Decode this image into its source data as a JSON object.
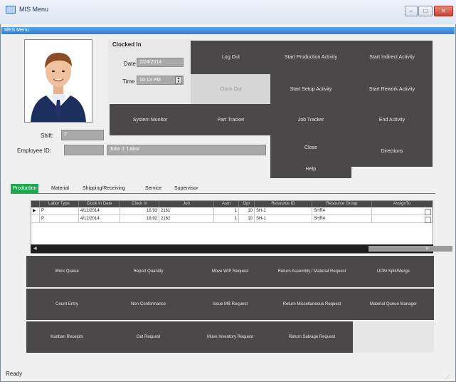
{
  "window": {
    "title": "MIS Menu",
    "menu": "MES Menu",
    "status": "Ready"
  },
  "clock": {
    "heading": "Clocked In",
    "date_label": "Date",
    "date_value": "2/24/2014",
    "time_label": "Time",
    "time_value": "10:13 PM"
  },
  "employee": {
    "shift_label": "Shift:",
    "shift_value": "2",
    "id_label": "Employee ID:",
    "id_value": "",
    "name_value": "John J. Labor"
  },
  "actions": {
    "log_out": "Log Out",
    "clock_out": "Clock Out",
    "start_production": "Start Production Activity",
    "start_indirect": "Start Indirect Activity",
    "start_setup": "Start Setup Activity",
    "start_rework": "Start Rework Activity",
    "system_monitor": "System Monitor",
    "part_tracker": "Part Tracker",
    "job_tracker": "Job Tracker",
    "end_activity": "End Activity",
    "close": "Close",
    "directions": "Directions",
    "help": "Help"
  },
  "tabs": [
    "Production",
    "Material",
    "Shipping/Receiving",
    "Service",
    "Supervisor"
  ],
  "table": {
    "headers": [
      "Labor Type",
      "Clock In Date",
      "Clock In",
      "Job",
      "Asm",
      "Opr",
      "Resource ID",
      "Resource Group",
      "AssignTo"
    ],
    "rows": [
      [
        "P",
        "4/12/2014",
        "16.93",
        "2161",
        "1",
        "10",
        "SH-1",
        "SHR4"
      ],
      [
        "P",
        "4/12/2014",
        "16.92",
        "2162",
        "1",
        "10",
        "SH-1",
        "SHR4"
      ]
    ]
  },
  "lower_buttons": [
    [
      "Work Queue",
      "Report Quantity",
      "Move WIP Request",
      "Return Assembly / Material Request",
      "UOM Split/Merge"
    ],
    [
      "Count Entry",
      "Non-Conformance",
      "Issue MB Request",
      "Return Miscellaneous Request",
      "Material Queue Manager"
    ],
    [
      "Kanban Receipts",
      "Get Request",
      "Move Inventory Request",
      "Return Salvage Request",
      ""
    ]
  ]
}
